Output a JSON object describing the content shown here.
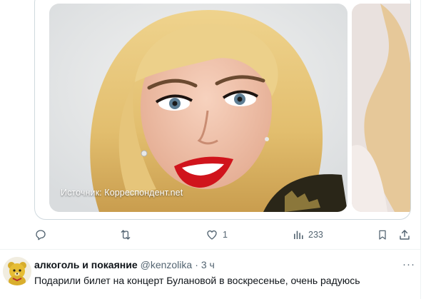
{
  "tweet_card": {
    "image_caption": "Источник: Корреспондент.net"
  },
  "action_bar": {
    "reply_count": "",
    "retweet_count": "",
    "like_count": "1",
    "views_count": "233"
  },
  "reply_post": {
    "display_name": "алкоголь и покаяние",
    "handle": "@kenzolika",
    "separator": "·",
    "time": "3 ч",
    "more_label": "···",
    "text": "Подарили билет на концерт Булановой в воскресенье, очень радуюсь"
  },
  "icons": {
    "reply": "reply-icon",
    "retweet": "retweet-icon",
    "like": "heart-icon",
    "views": "analytics-icon",
    "bookmark": "bookmark-icon",
    "share": "share-icon",
    "more": "more-icon"
  },
  "colors": {
    "secondary_text": "#536471",
    "primary_text": "#0f1419",
    "card_border": "#cfd9de",
    "divider": "#eff3f4"
  }
}
